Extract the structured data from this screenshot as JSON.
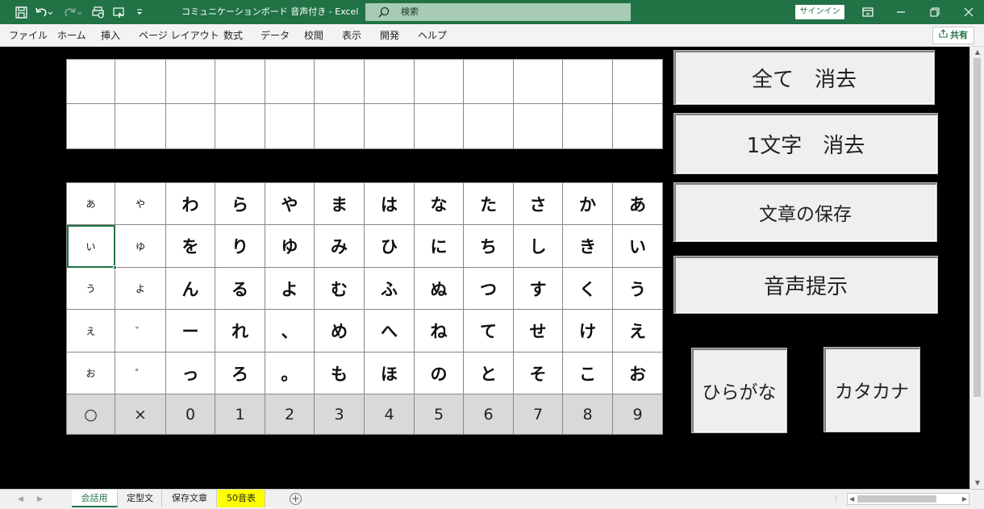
{
  "window": {
    "title": "コミュニケーションボード  音声付き  -  Excel",
    "search_label": "検索",
    "signin_label": "サインイン"
  },
  "ribbon": {
    "tabs": [
      "ファイル",
      "ホーム",
      "挿入",
      "ページ レイアウト",
      "数式",
      "データ",
      "校閲",
      "表示",
      "開発",
      "ヘルプ"
    ],
    "share_label": "共有"
  },
  "board": {
    "rows": [
      [
        "あ",
        "や",
        "わ",
        "ら",
        "や",
        "ま",
        "は",
        "な",
        "た",
        "さ",
        "か",
        "あ"
      ],
      [
        "い",
        "ゆ",
        "を",
        "り",
        "ゆ",
        "み",
        "ひ",
        "に",
        "ち",
        "し",
        "き",
        "い"
      ],
      [
        "う",
        "よ",
        "ん",
        "る",
        "よ",
        "む",
        "ふ",
        "ぬ",
        "つ",
        "す",
        "く",
        "う"
      ],
      [
        "え",
        "゛",
        "ー",
        "れ",
        "、",
        "め",
        "へ",
        "ね",
        "て",
        "せ",
        "け",
        "え"
      ],
      [
        "お",
        "゜",
        "っ",
        "ろ",
        "。",
        "も",
        "ほ",
        "の",
        "と",
        "そ",
        "こ",
        "お"
      ]
    ],
    "number_row": [
      "○",
      "×",
      "0",
      "1",
      "2",
      "3",
      "4",
      "5",
      "6",
      "7",
      "8",
      "9"
    ]
  },
  "buttons": {
    "clear_all": "全て　消去",
    "clear_one": "1文字　消去",
    "save_sentence": "文章の保存",
    "speak": "音声提示",
    "hiragana": "ひらがな",
    "katakana": "カタカナ"
  },
  "sheet_tabs": [
    "会話用",
    "定型文",
    "保存文章",
    "50音表"
  ],
  "colors": {
    "excel_green": "#217346",
    "highlight_tab": "#ffff00"
  }
}
